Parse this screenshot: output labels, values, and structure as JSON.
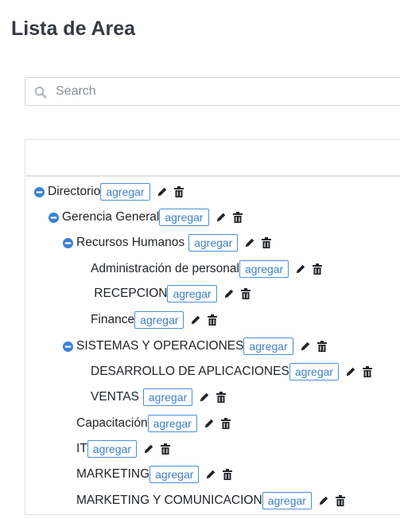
{
  "page": {
    "title": "Lista de Area"
  },
  "search": {
    "placeholder": "Search",
    "value": ""
  },
  "tree": {
    "add_label": "agregar",
    "nodes": [
      {
        "label": "Directorio",
        "expanded": true
      },
      {
        "label": "Gerencia General",
        "expanded": true
      },
      {
        "label": "Recursos Humanos",
        "expanded": true
      },
      {
        "label": "Administración de personal"
      },
      {
        "label": " RECEPCION"
      },
      {
        "label": "Finance"
      },
      {
        "label": "SISTEMAS Y OPERACIONES",
        "expanded": true
      },
      {
        "label": "DESARROLLO DE APLICACIONES"
      },
      {
        "label": "VENTAS"
      },
      {
        "label": "Capacitación"
      },
      {
        "label": "IT"
      },
      {
        "label": "MARKETING"
      },
      {
        "label": "MARKETING Y COMUNICACION"
      }
    ]
  },
  "colors": {
    "accent": "#3c7fc6",
    "collapse_icon": "#3b82d6",
    "title": "#343a40"
  }
}
